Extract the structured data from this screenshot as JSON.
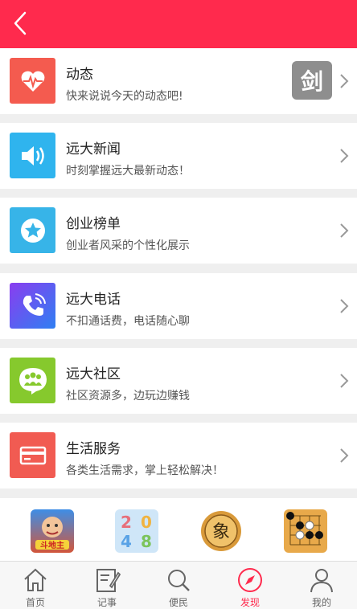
{
  "header": {
    "back_icon": "chevron-left-icon",
    "bg_color": "#ff2a4d"
  },
  "items": [
    {
      "title": "动态",
      "subtitle": "快来说说今天的动态吧!",
      "icon": "heart-pulse-icon",
      "color": "#f45b4f",
      "thumb_text": "剑"
    },
    {
      "title": "远大新闻",
      "subtitle": "时刻掌握远大最新动态！",
      "icon": "speaker-icon",
      "color": "#2fb4ee"
    },
    {
      "title": "创业榜单",
      "subtitle": "创业者风采的个性化展示",
      "icon": "star-icon",
      "color": "#37b4e8"
    },
    {
      "title": "远大电话",
      "subtitle": "不扣通话费，电话随心聊",
      "icon": "phone-icon",
      "color": "#5f4bf0"
    },
    {
      "title": "远大社区",
      "subtitle": "社区资源多，边玩边赚钱",
      "icon": "community-icon",
      "color": "#86c92d"
    },
    {
      "title": "生活服务",
      "subtitle": "各类生活需求，掌上轻松解决！",
      "icon": "card-icon",
      "color": "#f15b52"
    }
  ],
  "games": [
    {
      "name": "doudizhu-game-icon",
      "label": "斗地主"
    },
    {
      "name": "2048-game-icon",
      "label": "2048"
    },
    {
      "name": "xiangqi-game-icon",
      "label": "象"
    },
    {
      "name": "go-game-icon",
      "label": ""
    }
  ],
  "tabs": [
    {
      "label": "首页",
      "icon": "home-icon"
    },
    {
      "label": "记事",
      "icon": "notepad-icon"
    },
    {
      "label": "便民",
      "icon": "search-icon"
    },
    {
      "label": "发现",
      "icon": "compass-icon",
      "active": true
    },
    {
      "label": "我的",
      "icon": "user-icon"
    }
  ]
}
